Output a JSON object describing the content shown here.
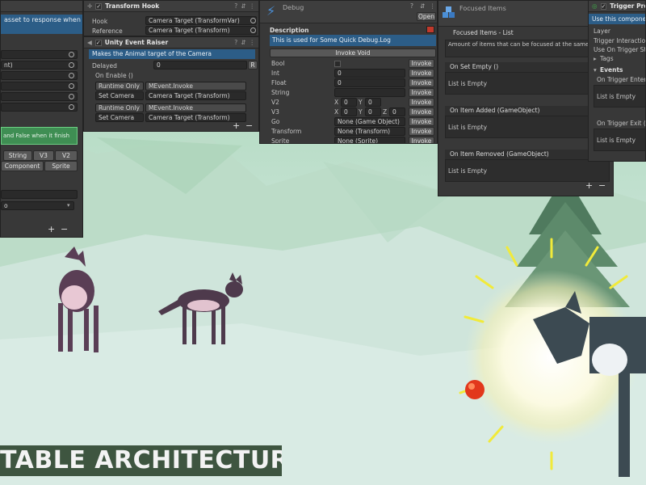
{
  "left_panel": {
    "desc": "asset to response when",
    "row_suffix": "nt)",
    "green_text": "and False when it finish",
    "type_buttons_row1": [
      "String",
      "V3",
      "V2"
    ],
    "type_buttons_row2": [
      "Component",
      "Sprite"
    ],
    "dropdown_value": "o",
    "plus": "+",
    "minus": "−"
  },
  "transform_hook": {
    "title": "Transform Hook",
    "hook_label": "Hook",
    "hook_value": "Camera Target (TransformVar)",
    "reference_label": "Reference",
    "reference_value": "Camera Target (Transform)"
  },
  "event_raiser": {
    "title": "Unity Event Raiser",
    "description": "Makes the Animal target of the Camera",
    "delayed_label": "Delayed",
    "delayed_value": "0",
    "r_button": "R",
    "on_enable": "On Enable ()",
    "entries": [
      {
        "mode": "Runtime Only",
        "method": "MEvent.Invoke",
        "target": "Set Camera ",
        "arg": "Camera Target (Transform)"
      },
      {
        "mode": "Runtime Only",
        "method": "MEvent.Invoke",
        "target": "Set Camera ",
        "arg": "Camera Target (Transform)"
      }
    ],
    "plus": "+",
    "minus": "−"
  },
  "debug": {
    "title": "Debug",
    "open_button": "Open",
    "description_label": "Description",
    "description_text": "This is used for Some Quick Debug.Log",
    "invoke_void": "Invoke Void",
    "invoke_label": "Invoke",
    "fields": [
      {
        "label": "Bool",
        "value": ""
      },
      {
        "label": "Int",
        "value": "0"
      },
      {
        "label": "Float",
        "value": "0"
      },
      {
        "label": "String",
        "value": ""
      },
      {
        "label": "V2",
        "value": ""
      },
      {
        "label": "V3",
        "value": ""
      },
      {
        "label": "Go",
        "value": "None (Game Object)"
      },
      {
        "label": "Transform",
        "value": "None (Transform)"
      },
      {
        "label": "Sprite",
        "value": "None (Sprite)"
      }
    ],
    "v2": {
      "x_label": "X",
      "x": "0",
      "y_label": "Y",
      "y": "0"
    },
    "v3": {
      "x_label": "X",
      "x": "0",
      "y_label": "Y",
      "y": "0",
      "z_label": "Z",
      "z": "0"
    }
  },
  "focused_items": {
    "title": "Focused Items",
    "list_title": "Focused Items - List",
    "amount_text": "Amount of items that can be focused at the same time",
    "events": [
      {
        "label": "On Set Empty ()",
        "empty": "List is Empty"
      },
      {
        "label": "On Item Added (GameObject)",
        "empty": "List is Empty"
      },
      {
        "label": "On Item Removed (GameObject)",
        "empty": "List is Empty"
      }
    ],
    "plus": "+",
    "minus": "−"
  },
  "trigger_proxy": {
    "title": "Trigger Proxy",
    "use_text": "Use this component",
    "items": [
      "Layer",
      "Trigger Interaction",
      "Use On Trigger Stay"
    ],
    "tags": "Tags",
    "events_label": "Events",
    "enter": "On Trigger Enter (Coll",
    "exit": "On Trigger Exit (Coll",
    "empty": "List is Empty"
  },
  "caption": "TABLE ARCHITECTURE",
  "colors": {
    "panel_bg": "#383838",
    "accent_blue": "#2c5d87",
    "accent_green": "#3f8e53",
    "caption_bg": "#3e5540"
  }
}
